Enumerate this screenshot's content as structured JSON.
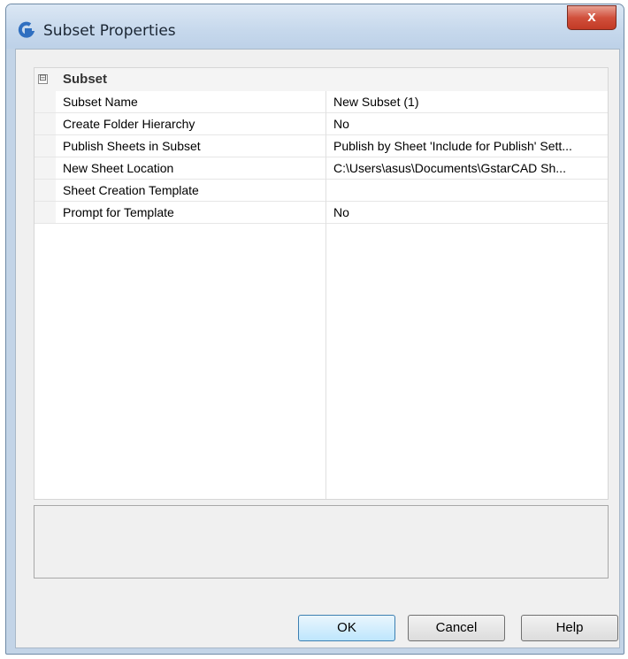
{
  "window": {
    "title": "Subset Properties",
    "close_label": "x"
  },
  "group": {
    "label": "Subset",
    "collapse_glyph": "⊟"
  },
  "properties": [
    {
      "name": "Subset Name",
      "value": "New Subset (1)"
    },
    {
      "name": "Create Folder Hierarchy",
      "value": "No"
    },
    {
      "name": "Publish Sheets in Subset",
      "value": "Publish by Sheet 'Include for Publish' Sett..."
    },
    {
      "name": "New Sheet Location",
      "value": "C:\\Users\\asus\\Documents\\GstarCAD Sh..."
    },
    {
      "name": "Sheet Creation Template",
      "value": ""
    },
    {
      "name": "Prompt for Template",
      "value": "No"
    }
  ],
  "description": "",
  "buttons": {
    "ok": "OK",
    "cancel": "Cancel",
    "help": "Help"
  },
  "colors": {
    "titlebar": "#c6d8ec",
    "close_button": "#c23a25",
    "app_icon": "#2f6fc0"
  }
}
